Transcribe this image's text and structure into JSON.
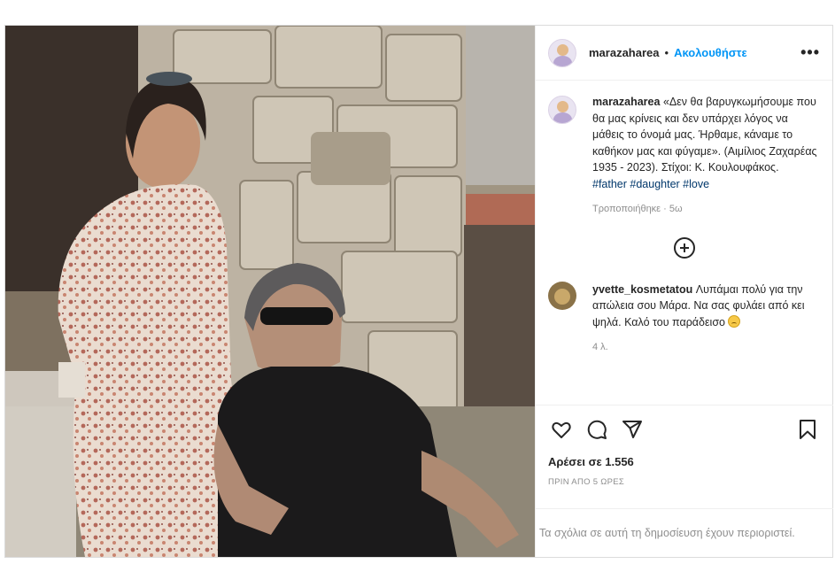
{
  "post": {
    "author": "marazaharea",
    "separator": "•",
    "follow_label": "Ακολουθήστε",
    "more_label": "•••",
    "caption_user": "marazaharea",
    "caption_text": "«Δεν θα βαρυγκωμήσουμε που θα μας κρίνεις και δεν υπάρχει λόγος να μάθεις το όνομά μας. Ήρθαμε, κάναμε το καθήκον μας και φύγαμε». (Αιμίλιος Ζαχαρέας 1935 - 2023). Στίχοι: Κ. Κουλουφάκος.",
    "caption_tags": "#father #daughter #love",
    "caption_meta": "Τροποποιήθηκε · 5ω",
    "likes_label": "Αρέσει σε 1.556",
    "time_label": "ΠΡΙΝ ΑΠΟ 5 ΩΡΕΣ",
    "comments_restricted": "Τα σχόλια σε αυτή τη δημοσίευση έχουν περιοριστεί."
  },
  "comments": [
    {
      "user": "yvette_kosmetatou",
      "text": "Λυπάμαι πολύ για την απώλεια σου Μάρα. Να σας φυλάει από κει ψηλά. Καλό του παράδεισο",
      "emoji": "sad-face-emoji",
      "time": "4 λ."
    }
  ],
  "icons": {
    "like": "heart-icon",
    "comment": "comment-icon",
    "share": "send-icon",
    "save": "bookmark-icon",
    "more": "more-options-icon",
    "load_more": "plus-circle-icon"
  },
  "colors": {
    "link": "#0095f6",
    "hashtag": "#00376b",
    "muted": "#8e8e8e",
    "text": "#262626"
  }
}
